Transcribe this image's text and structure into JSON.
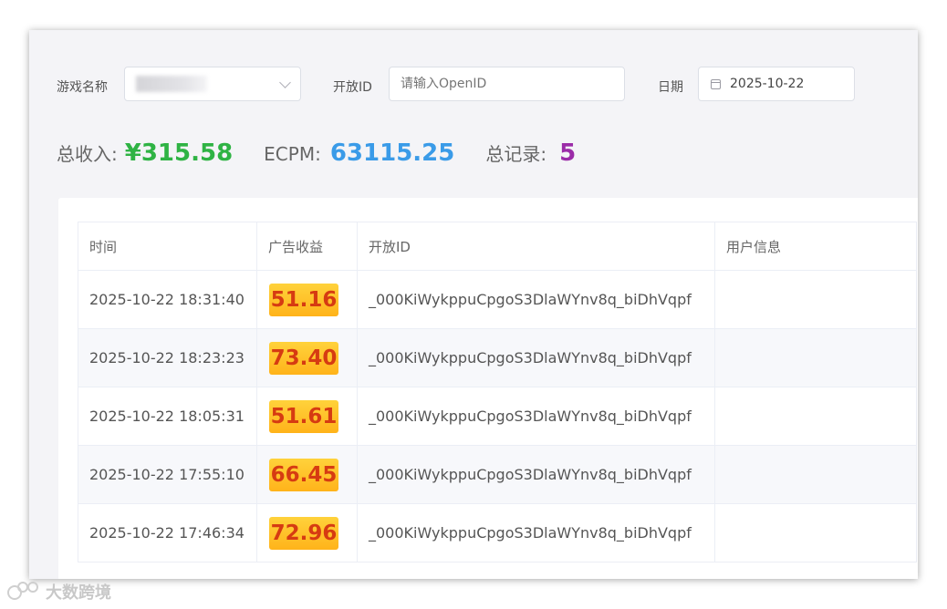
{
  "filters": {
    "game_name_label": "游戏名称",
    "openid_label": "开放ID",
    "openid_placeholder": "请输入OpenID",
    "date_label": "日期",
    "date_value": "2025-10-22"
  },
  "stats": {
    "total_revenue_label": "总收入:",
    "total_revenue_value": "¥315.58",
    "ecpm_label": "ECPM:",
    "ecpm_value": "63115.25",
    "total_records_label": "总记录:",
    "total_records_value": "5"
  },
  "table": {
    "headers": [
      "时间",
      "广告收益",
      "开放ID",
      "用户信息"
    ],
    "rows": [
      {
        "time": "2025-10-22 18:31:40",
        "revenue": "51.16",
        "openid": "_000KiWykppuCpgoS3DlaWYnv8q_biDhVqpf",
        "user": ""
      },
      {
        "time": "2025-10-22 18:23:23",
        "revenue": "73.40",
        "openid": "_000KiWykppuCpgoS3DlaWYnv8q_biDhVqpf",
        "user": ""
      },
      {
        "time": "2025-10-22 18:05:31",
        "revenue": "51.61",
        "openid": "_000KiWykppuCpgoS3DlaWYnv8q_biDhVqpf",
        "user": ""
      },
      {
        "time": "2025-10-22 17:55:10",
        "revenue": "66.45",
        "openid": "_000KiWykppuCpgoS3DlaWYnv8q_biDhVqpf",
        "user": ""
      },
      {
        "time": "2025-10-22 17:46:34",
        "revenue": "72.96",
        "openid": "_000KiWykppuCpgoS3DlaWYnv8q_biDhVqpf",
        "user": ""
      }
    ]
  },
  "colors": {
    "revenue_green": "#2fb344",
    "ecpm_blue": "#3a9be8",
    "records_purple": "#9b2ca8",
    "badge_yellow": "#ffc22a",
    "badge_text": "#d63b12"
  },
  "watermark": {
    "text": "大数跨境"
  }
}
